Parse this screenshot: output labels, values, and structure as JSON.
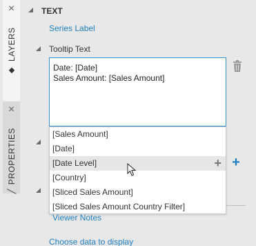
{
  "tabs": {
    "layers": {
      "label": "LAYERS",
      "close": "×"
    },
    "properties": {
      "label": "PROPERTIES",
      "close": "×"
    }
  },
  "panel_close": "×",
  "section": {
    "title": "TEXT",
    "series_label_link": "Series Label",
    "tooltip_label": "Tooltip Text",
    "tooltip_value": "Date: [Date]\nSales Amount: [Sales Amount]",
    "viewer_notes_link": "Viewer Notes",
    "choose_data_link": "Choose data to display"
  },
  "dropdown": {
    "options": [
      "[Sales Amount]",
      "[Date]",
      "[Date Level]",
      "[Country]",
      "[Sliced Sales Amount]",
      "[Sliced Sales Amount Country Filter]"
    ],
    "hovered_index": 2,
    "insert_glyph": "+"
  },
  "add_glyph": "+",
  "colors": {
    "accent": "#1f7fc4",
    "focus_border": "#3b8dcc",
    "background": "#e8e8e8"
  },
  "icons": {
    "trash": "trash-icon",
    "layers": "layers-icon",
    "brush": "brush-icon",
    "cursor": "pointer-cursor-icon"
  }
}
